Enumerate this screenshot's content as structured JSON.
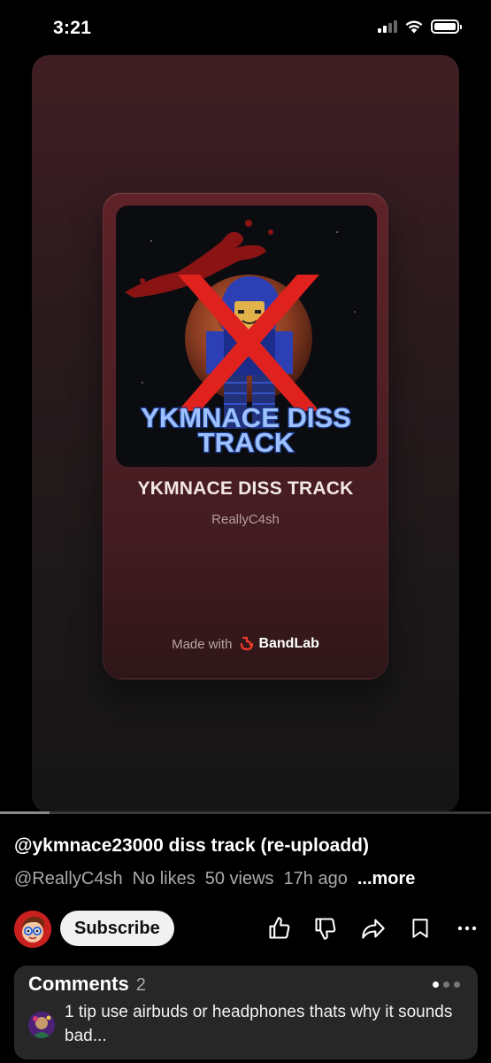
{
  "status_bar": {
    "time": "3:21",
    "battery_level": 1.0,
    "signal_bars": 2
  },
  "card": {
    "artwork_text": "YKMNACE DISS TRACK",
    "title": "YKMNACE DISS TRACK",
    "artist": "ReallyC4sh",
    "made_with": "Made with",
    "brand": "BandLab",
    "brand_color": "#f23c2b"
  },
  "playback": {
    "progress": 0.1
  },
  "video": {
    "title": "@ykmnace23000 diss track (re-uploadd)",
    "channel": "@ReallyC4sh",
    "likes": "No likes",
    "views": "50 views",
    "age": "17h ago",
    "more_label": "...more"
  },
  "actions": {
    "subscribe_label": "Subscribe",
    "icons": [
      "like-icon",
      "dislike-icon",
      "share-icon",
      "save-icon",
      "more-icon"
    ]
  },
  "comments": {
    "label": "Comments",
    "count": "2",
    "preview_text": "1 tip use airbuds or headphones thats why it sounds bad..."
  },
  "colors": {
    "background": "#000000",
    "card_accent": "#5e2228",
    "cross_red": "#e0221f"
  }
}
